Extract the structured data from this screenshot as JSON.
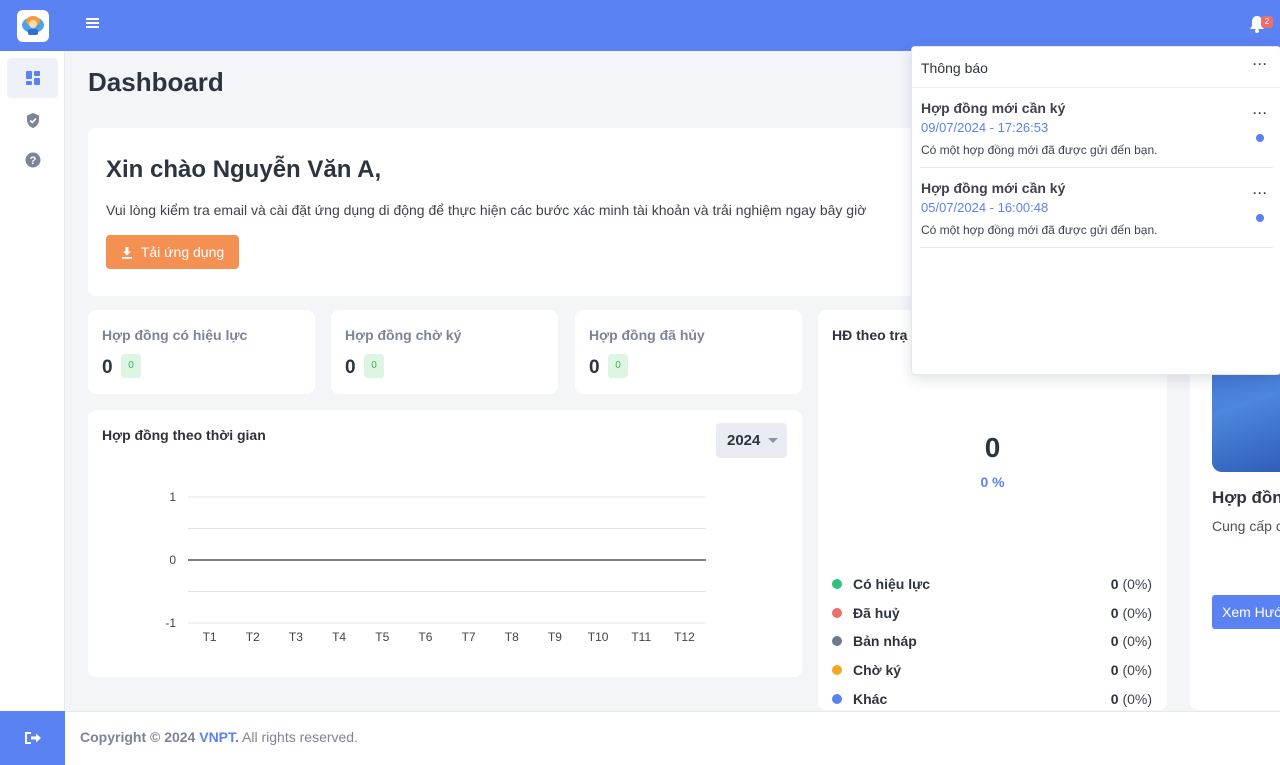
{
  "topbar": {
    "notification_count": "2"
  },
  "page_title": "Dashboard",
  "welcome": {
    "greeting": "Xin chào Nguyễn Văn A,",
    "message": "Vui lòng kiểm tra email và cài đặt ứng dụng di động để thực hiện các bước xác minh tài khoản và trải nghiệm ngay bây giờ",
    "download_button": "Tải ứng dụng"
  },
  "stats": [
    {
      "label": "Hợp đồng có hiệu lực",
      "value": "0",
      "badge": "0"
    },
    {
      "label": "Hợp đồng chờ ký",
      "value": "0",
      "badge": "0"
    },
    {
      "label": "Hợp đồng đã hủy",
      "value": "0",
      "badge": "0"
    }
  ],
  "time_chart": {
    "title": "Hợp đồng theo thời gian",
    "year": "2024"
  },
  "chart_data": {
    "type": "line",
    "categories": [
      "T1",
      "T2",
      "T3",
      "T4",
      "T5",
      "T6",
      "T7",
      "T8",
      "T9",
      "T10",
      "T11",
      "T12"
    ],
    "series": [
      {
        "values": [
          0,
          0,
          0,
          0,
          0,
          0,
          0,
          0,
          0,
          0,
          0,
          0
        ]
      }
    ],
    "yticks": [
      "1",
      "0",
      "-1"
    ],
    "ylim": [
      -1,
      1
    ],
    "grid": true
  },
  "status_chart": {
    "title": "HĐ theo trạ",
    "total": "0",
    "percent": "0 %",
    "legend": [
      {
        "name": "Có hiệu lực",
        "value": "0",
        "pct": "(0%)",
        "color": "#2ec27e"
      },
      {
        "name": "Đã huỷ",
        "value": "0",
        "pct": "(0%)",
        "color": "#f06d6d"
      },
      {
        "name": "Bản nháp",
        "value": "0",
        "pct": "(0%)",
        "color": "#6b7a90"
      },
      {
        "name": "Chờ ký",
        "value": "0",
        "pct": "(0%)",
        "color": "#f5a623"
      },
      {
        "name": "Khác",
        "value": "0",
        "pct": "(0%)",
        "color": "#5b82f2"
      }
    ]
  },
  "guide_card": {
    "title": "Hợp đồn",
    "desc": "Cung cấp c bên giao k điện tử.",
    "button": "Xem Hướ"
  },
  "footer": {
    "prefix": "Copyright © 2024",
    "brand": "VNPT.",
    "suffix": "All rights reserved."
  },
  "notifications": {
    "title": "Thông báo",
    "more": "···",
    "items": [
      {
        "title": "Hợp đồng mới cần ký",
        "datetime": "09/07/2024 - 17:26:53",
        "message": "Có một hợp đồng mới đã được gửi đến bạn."
      },
      {
        "title": "Hợp đồng mới cần ký",
        "datetime": "05/07/2024 - 16:00:48",
        "message": "Có một hợp đồng mới đã được gửi đến bạn."
      }
    ]
  }
}
